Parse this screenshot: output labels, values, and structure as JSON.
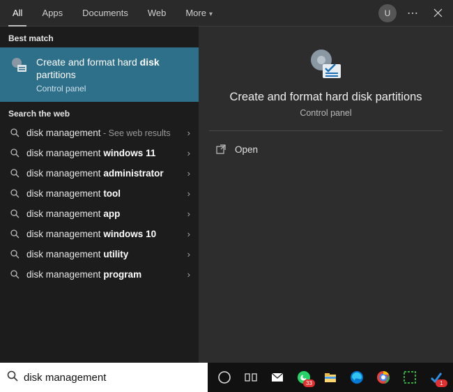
{
  "tabs": {
    "items": [
      "All",
      "Apps",
      "Documents",
      "Web",
      "More"
    ],
    "active_index": 0
  },
  "user_initial": "U",
  "left": {
    "best_match_label": "Best match",
    "best_match": {
      "title_prefix": "Create and format hard ",
      "title_bold": "disk",
      "title_suffix_line2": "partitions",
      "subtitle": "Control panel"
    },
    "web_label": "Search the web",
    "web_results": [
      {
        "prefix": "disk management",
        "bold": "",
        "hint": " - See web results"
      },
      {
        "prefix": "disk management ",
        "bold": "windows 11",
        "hint": ""
      },
      {
        "prefix": "disk management ",
        "bold": "administrator",
        "hint": ""
      },
      {
        "prefix": "disk management ",
        "bold": "tool",
        "hint": ""
      },
      {
        "prefix": "disk management ",
        "bold": "app",
        "hint": ""
      },
      {
        "prefix": "disk management ",
        "bold": "windows 10",
        "hint": ""
      },
      {
        "prefix": "disk management ",
        "bold": "utility",
        "hint": ""
      },
      {
        "prefix": "disk management ",
        "bold": "program",
        "hint": ""
      }
    ]
  },
  "right": {
    "title": "Create and format hard disk partitions",
    "subtitle": "Control panel",
    "actions": [
      {
        "label": "Open",
        "icon": "open-icon"
      }
    ]
  },
  "search": {
    "value": "disk management",
    "placeholder": "Type here to search"
  },
  "taskbar": {
    "items": [
      {
        "name": "cortana-icon"
      },
      {
        "name": "task-view-icon"
      },
      {
        "name": "mail-icon"
      },
      {
        "name": "whatsapp-icon",
        "badge": "33"
      },
      {
        "name": "file-explorer-icon"
      },
      {
        "name": "edge-icon"
      },
      {
        "name": "chrome-icon"
      },
      {
        "name": "app-green-icon"
      },
      {
        "name": "app-blue-check-icon",
        "badge": "1"
      }
    ]
  }
}
